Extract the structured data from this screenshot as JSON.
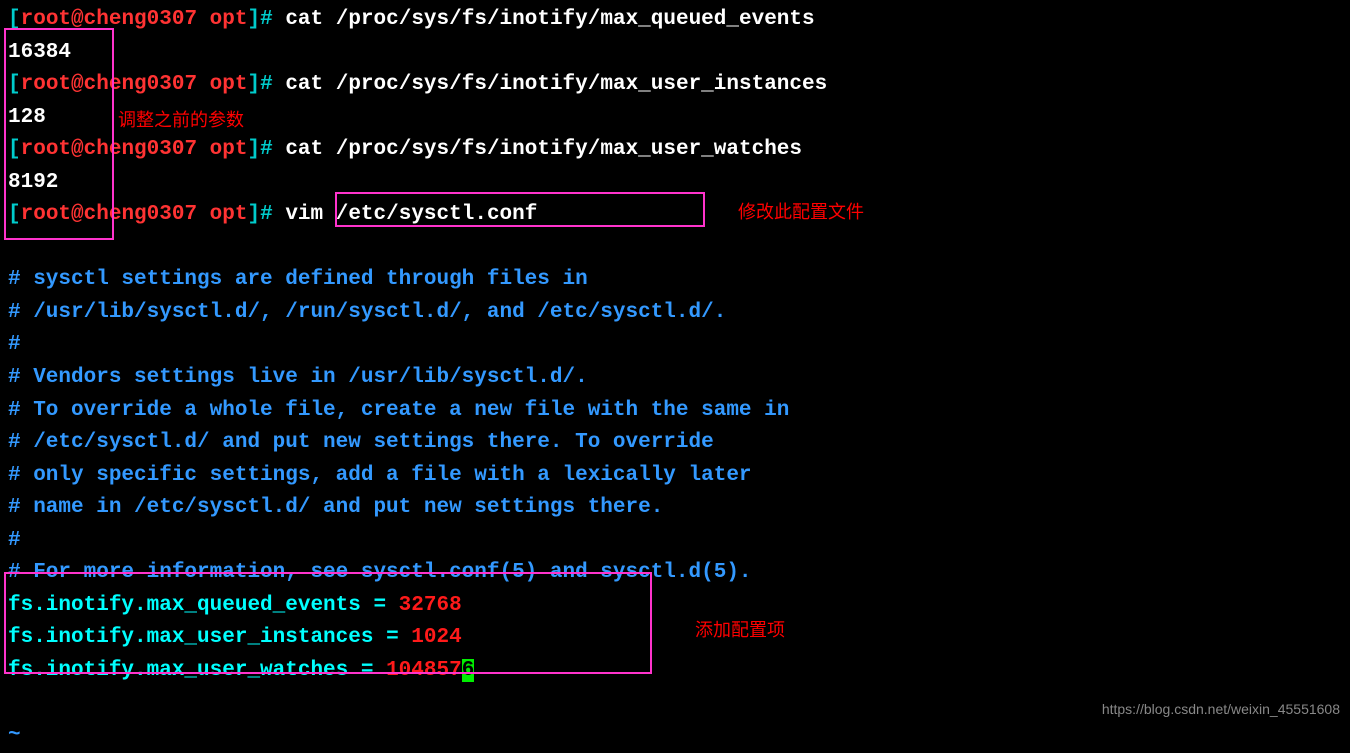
{
  "prompt": {
    "open": "[",
    "user": "root",
    "at": "@",
    "host": "cheng0307",
    "space": " ",
    "dir": "opt",
    "close": "]",
    "hash": "# "
  },
  "lines": {
    "cmd1": "cat /proc/sys/fs/inotify/max_queued_events",
    "out1": "16384",
    "cmd2": "cat /proc/sys/fs/inotify/max_user_instances",
    "out2": "128",
    "cmd3": "cat /proc/sys/fs/inotify/max_user_watches",
    "out3": "8192",
    "cmd4": "vim /etc/sysctl.conf"
  },
  "comments": {
    "c1": "# sysctl settings are defined through files in",
    "c2": "# /usr/lib/sysctl.d/, /run/sysctl.d/, and /etc/sysctl.d/.",
    "c3": "#",
    "c4": "# Vendors settings live in /usr/lib/sysctl.d/.",
    "c5": "# To override a whole file, create a new file with the same in",
    "c6": "# /etc/sysctl.d/ and put new settings there. To override",
    "c7": "# only specific settings, add a file with a lexically later",
    "c8": "# name in /etc/sysctl.d/ and put new settings there.",
    "c9": "#",
    "c10": "# For more information, see sysctl.conf(5) and sysctl.d(5)."
  },
  "settings": {
    "s1": {
      "key": "fs.inotify.max_queued_events",
      "eq": " = ",
      "val": "32768"
    },
    "s2": {
      "key": "fs.inotify.max_user_instances",
      "eq": " = ",
      "val": "1024"
    },
    "s3": {
      "key": "fs.inotify.max_user_watches",
      "eq": " = ",
      "val_pre": "104857",
      "val_cur": "6"
    }
  },
  "tilde": "~",
  "annotations": {
    "a1": "调整之前的参数",
    "a2": "修改此配置文件",
    "a3": "添加配置项"
  },
  "watermark": "https://blog.csdn.net/weixin_45551608"
}
